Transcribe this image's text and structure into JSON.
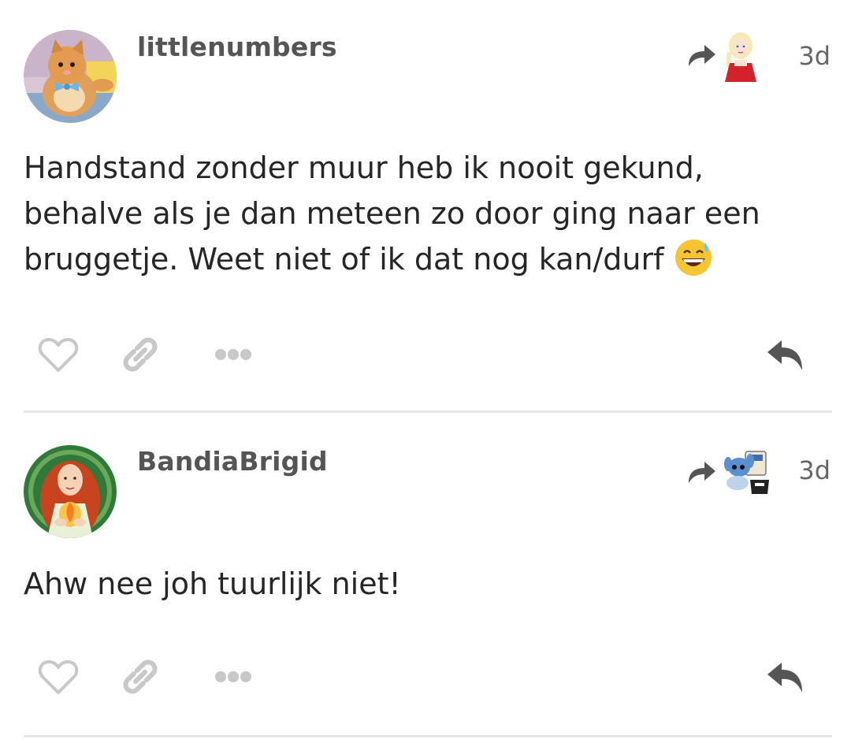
{
  "comments": [
    {
      "username": "littlenumbers",
      "timestamp": "3d",
      "text_lines": [
        "Handstand zonder muur heb ik nooit gekund,",
        "behalve als je dan meteen zo door ging naar een",
        "bruggetje. Weet niet of ik dat nog kan/durf"
      ],
      "avatar_icon": "cat-avatar",
      "reblog_source_icon": "princess-avatar",
      "emoji_icon": "grinning-sweat-emoji"
    },
    {
      "username": "BandiaBrigid",
      "timestamp": "3d",
      "text_lines": [
        "Ahw nee joh tuurlijk niet!"
      ],
      "avatar_icon": "red-haired-woman-avatar",
      "reblog_source_icon": "stitch-avatar"
    }
  ],
  "actions": [
    "heart-icon",
    "link-icon",
    "more-icon",
    "reply-icon"
  ],
  "colors": {
    "icon_gray": "#c8c8c8",
    "reply_gray": "#555555",
    "username_gray": "#555555",
    "text": "#262626",
    "divider": "#e6e6e6"
  }
}
